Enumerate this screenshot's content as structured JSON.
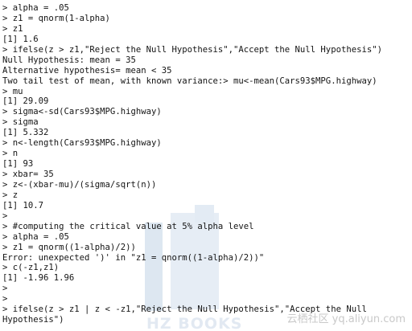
{
  "console": {
    "lines": [
      "> alpha = .05",
      "> z1 = qnorm(1-alpha)",
      "> z1",
      "[1] 1.6",
      "> ifelse(z > z1,\"Reject the Null Hypothesis\",\"Accept the Null Hypothesis\")",
      "Null Hypothesis: mean = 35",
      "Alternative hypothesis= mean < 35",
      "Two tail test of mean, with known variance:> mu<-mean(Cars93$MPG.highway)",
      "> mu",
      "[1] 29.09",
      "> sigma<-sd(Cars93$MPG.highway)",
      "> sigma",
      "[1] 5.332",
      "> n<-length(Cars93$MPG.highway)",
      "> n",
      "[1] 93",
      "> xbar= 35",
      "> z<-(xbar-mu)/(sigma/sqrt(n))",
      "> z",
      "[1] 10.7",
      ">",
      "> #computing the critical value at 5% alpha level",
      "> alpha = .05",
      "> z1 = qnorm((1-alpha)/2))",
      "Error: unexpected ')' in \"z1 = qnorm((1-alpha)/2))\"",
      "> c(-z1,z1)",
      "[1] -1.96 1.96",
      ">",
      ">",
      "> ifelse(z > z1 | z < -z1,\"Reject the Null Hypothesis\",\"Accept the Null",
      "Hypothesis\")"
    ]
  },
  "watermark": {
    "brand": "HZ BOOKS",
    "site": "云栖社区 yq.aliyun.com"
  }
}
